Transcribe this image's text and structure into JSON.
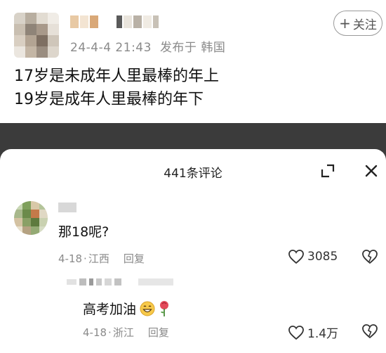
{
  "post": {
    "date": "24-4-4 21:43",
    "published_at": "发布于 韩国",
    "follow_label": "关注",
    "lines": [
      "17岁是未成年人里最棒的年上",
      "19岁是成年人里最棒的年下"
    ]
  },
  "comments_sheet": {
    "title": "441条评论",
    "comments": [
      {
        "text": "那18呢?",
        "date": "4-18",
        "location": "江西",
        "reply_label": "回复",
        "likes": "3085"
      }
    ],
    "replies": [
      {
        "text": "高考加油",
        "emojis": [
          "grinning-face-icon",
          "rose-icon"
        ],
        "date": "4-18",
        "location": "浙江",
        "reply_label": "回复",
        "likes": "1.4万"
      }
    ]
  },
  "colors": {
    "meta_gray": "#8a8a8a",
    "dark_band": "#3b3b3b",
    "text": "#111111"
  }
}
